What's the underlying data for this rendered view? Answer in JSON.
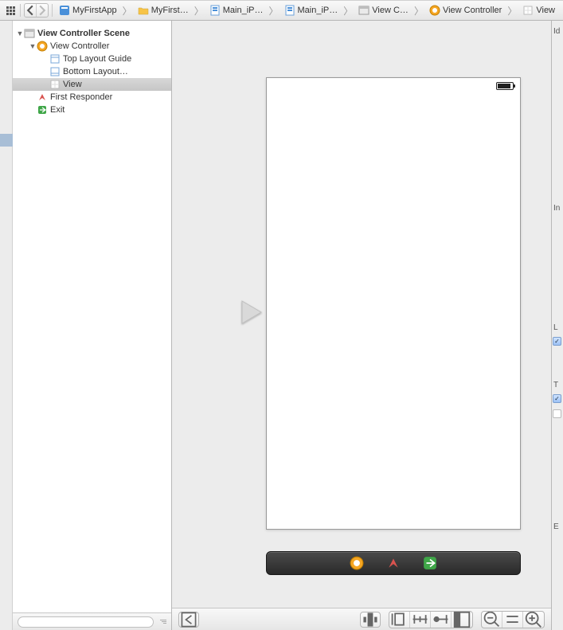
{
  "breadcrumb": {
    "items": [
      {
        "label": "MyFirstApp",
        "icon": "app-icon"
      },
      {
        "label": "MyFirst…",
        "icon": "folder-icon"
      },
      {
        "label": "Main_iP…",
        "icon": "storyboard-icon"
      },
      {
        "label": "Main_iP…",
        "icon": "storyboard-icon"
      },
      {
        "label": "View C…",
        "icon": "scene-icon"
      },
      {
        "label": "View Controller",
        "icon": "viewcontroller-icon"
      },
      {
        "label": "View",
        "icon": "view-icon"
      }
    ]
  },
  "outline": {
    "scene": {
      "label": "View Controller Scene"
    },
    "viewController": {
      "label": "View Controller"
    },
    "topLayout": {
      "label": "Top Layout Guide"
    },
    "bottomLayout": {
      "label": "Bottom Layout…"
    },
    "view": {
      "label": "View"
    },
    "firstResponder": {
      "label": "First Responder"
    },
    "exit": {
      "label": "Exit"
    }
  },
  "inspector": {
    "section1": "Id",
    "section2": "In",
    "section3": "L",
    "section4": "T",
    "section5": "E"
  }
}
